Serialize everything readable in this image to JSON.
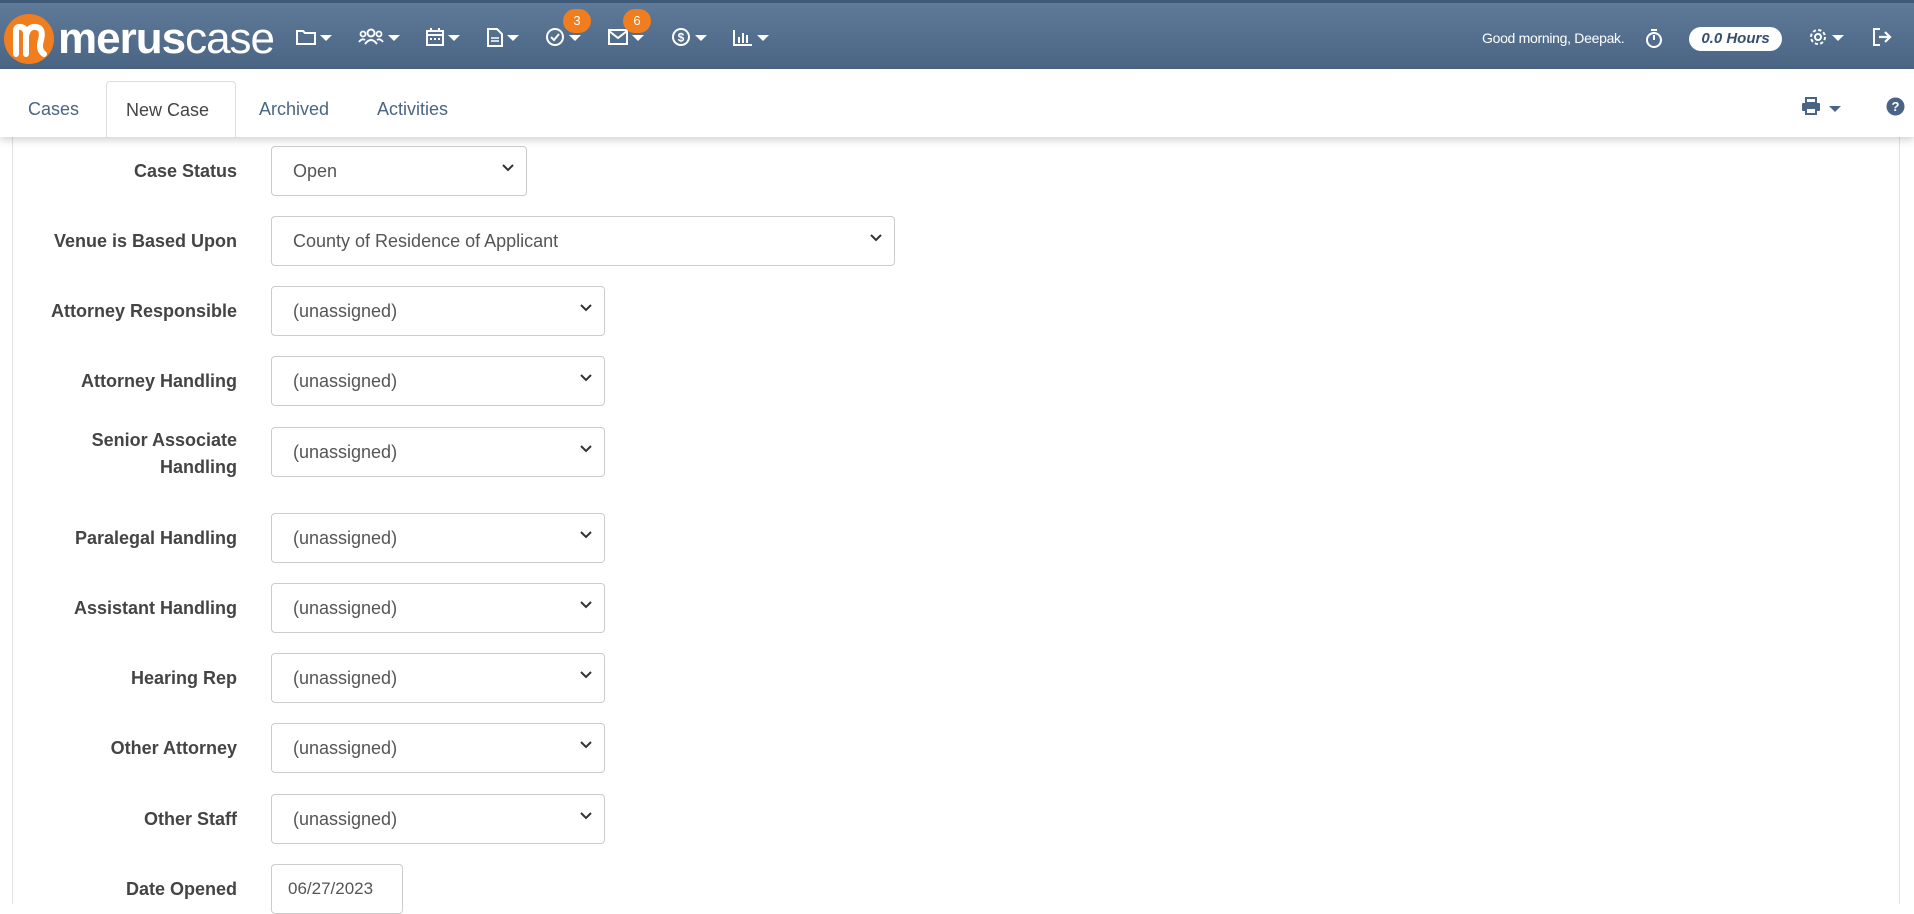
{
  "app": {
    "logo_bold": "merus",
    "logo_light": "case",
    "brand_color": "#f07d1e",
    "nav_color": "#4e6a89"
  },
  "topnav": {
    "icons": [
      "folder-icon",
      "users-icon",
      "calendar-icon",
      "document-icon",
      "tasks-check-icon",
      "envelope-icon",
      "dollar-icon",
      "bar-chart-icon"
    ],
    "tasks_badge": "3",
    "messages_badge": "6",
    "greeting": "Good morning, Deepak.",
    "hours": "0.0 Hours"
  },
  "tabs": [
    {
      "label": "Cases",
      "active": false
    },
    {
      "label": "New Case",
      "active": true
    },
    {
      "label": "Archived",
      "active": false
    },
    {
      "label": "Activities",
      "active": false
    }
  ],
  "form": {
    "case_status": {
      "label": "Case Status",
      "value": "Open"
    },
    "venue": {
      "label": "Venue is Based Upon",
      "value": "County of Residence of Applicant"
    },
    "attorney_responsible": {
      "label": "Attorney Responsible",
      "value": "(unassigned)"
    },
    "attorney_handling": {
      "label": "Attorney Handling",
      "value": "(unassigned)"
    },
    "senior_associate": {
      "label_line1": "Senior Associate",
      "label_line2": "Handling",
      "value": "(unassigned)"
    },
    "paralegal": {
      "label": "Paralegal Handling",
      "value": "(unassigned)"
    },
    "assistant": {
      "label": "Assistant Handling",
      "value": "(unassigned)"
    },
    "hearing_rep": {
      "label": "Hearing Rep",
      "value": "(unassigned)"
    },
    "other_attorney": {
      "label": "Other Attorney",
      "value": "(unassigned)"
    },
    "other_staff": {
      "label": "Other Staff",
      "value": "(unassigned)"
    },
    "date_opened": {
      "label": "Date Opened",
      "value": "06/27/2023"
    }
  }
}
